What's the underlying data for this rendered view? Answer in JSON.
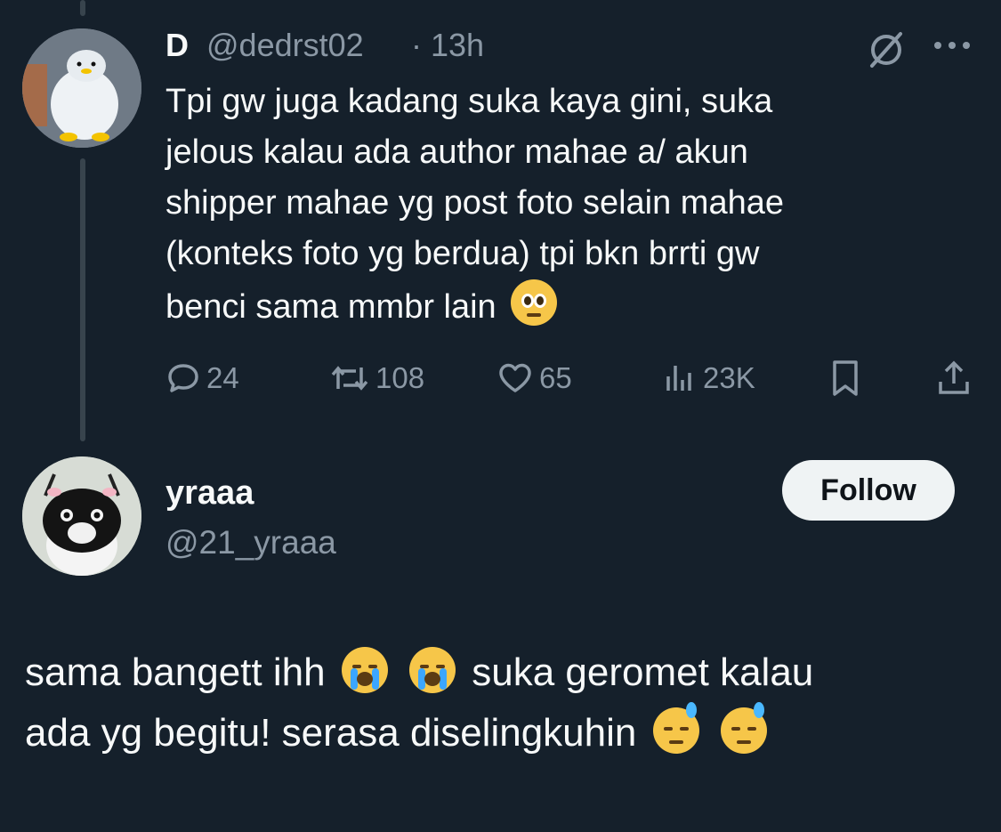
{
  "parent_tweet": {
    "display_name": "D",
    "handle": "@dedrst02",
    "separator": "·",
    "time": "13h",
    "text_lines": [
      "Tpi gw juga kadang suka kaya gini, suka",
      "jelous kalau ada author mahae a/ akun",
      "shipper mahae yg post foto selain mahae",
      "(konteks foto yg berdua) tpi bkn brrti gw",
      "benci sama mmbr lain"
    ],
    "emoji": "pleading-face",
    "replies": "24",
    "reposts": "108",
    "likes": "65",
    "views": "23K"
  },
  "reply_tweet": {
    "display_name": "yraaa",
    "handle": "@21_yraaa",
    "follow_label": "Follow",
    "text_line1_a": "sama bangett ihh",
    "text_line1_b": "suka geromet kalau",
    "text_line2": "ada yg begitu! serasa diselingkuhin",
    "emojis": [
      "loudly-crying-face",
      "loudly-crying-face",
      "downcast-face-with-sweat",
      "downcast-face-with-sweat"
    ]
  },
  "icons": [
    "grok-icon",
    "more-icon",
    "reply-icon",
    "repost-icon",
    "like-icon",
    "views-icon",
    "bookmark-icon",
    "share-icon"
  ],
  "colors": {
    "background": "#15202b",
    "text": "#f7f9f9",
    "secondary": "#8b98a5",
    "follow_bg": "#eff3f4"
  }
}
